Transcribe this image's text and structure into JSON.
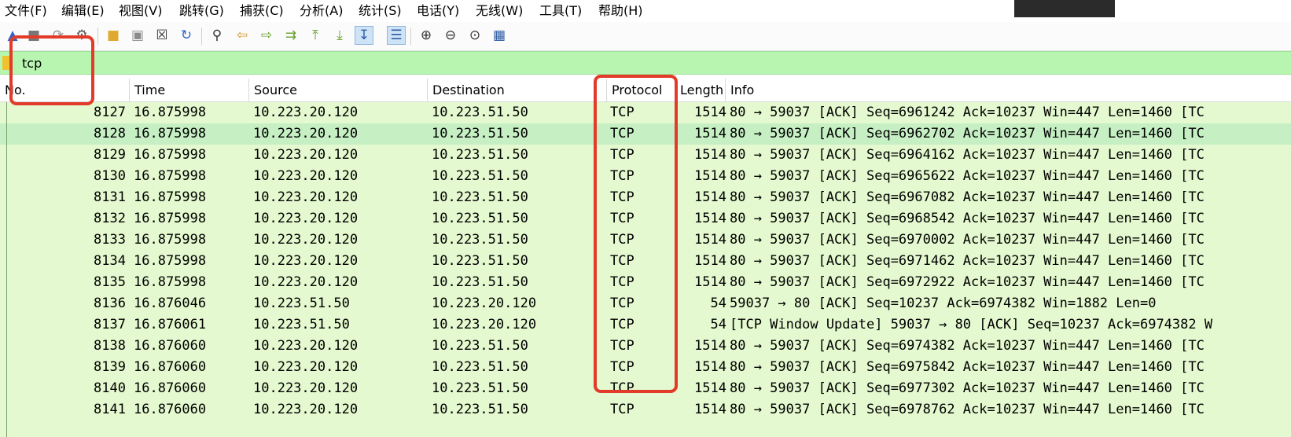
{
  "menu": [
    "文件(F)",
    "编辑(E)",
    "视图(V)",
    "跳转(G)",
    "捕获(C)",
    "分析(A)",
    "统计(S)",
    "电话(Y)",
    "无线(W)",
    "工具(T)",
    "帮助(H)"
  ],
  "toolbar": {
    "icons": [
      "shark-fin-icon",
      "stop-icon",
      "restart-icon",
      "options-gear-icon",
      "open-folder-icon",
      "save-file-icon",
      "close-file-icon",
      "reload-icon",
      "find-icon",
      "back-arrow-icon",
      "forward-arrow-icon",
      "go-to-packet-icon",
      "first-packet-icon",
      "last-packet-icon",
      "autoscroll-icon",
      "colorize-icon",
      "zoom-in-icon",
      "zoom-out-icon",
      "zoom-reset-icon",
      "resize-columns-icon"
    ]
  },
  "filter": {
    "value": "tcp"
  },
  "columns": {
    "no": "No.",
    "time": "Time",
    "source": "Source",
    "destination": "Destination",
    "protocol": "Protocol",
    "length": "Length",
    "info": "Info"
  },
  "packets": [
    {
      "no": "8127",
      "time": "16.875998",
      "src": "10.223.20.120",
      "dst": "10.223.51.50",
      "proto": "TCP",
      "len": "1514",
      "info": "80 → 59037 [ACK] Seq=6961242 Ack=10237 Win=447 Len=1460 [TC"
    },
    {
      "no": "8128",
      "time": "16.875998",
      "src": "10.223.20.120",
      "dst": "10.223.51.50",
      "proto": "TCP",
      "len": "1514",
      "info": "80 → 59037 [ACK] Seq=6962702 Ack=10237 Win=447 Len=1460 [TC"
    },
    {
      "no": "8129",
      "time": "16.875998",
      "src": "10.223.20.120",
      "dst": "10.223.51.50",
      "proto": "TCP",
      "len": "1514",
      "info": "80 → 59037 [ACK] Seq=6964162 Ack=10237 Win=447 Len=1460 [TC"
    },
    {
      "no": "8130",
      "time": "16.875998",
      "src": "10.223.20.120",
      "dst": "10.223.51.50",
      "proto": "TCP",
      "len": "1514",
      "info": "80 → 59037 [ACK] Seq=6965622 Ack=10237 Win=447 Len=1460 [TC"
    },
    {
      "no": "8131",
      "time": "16.875998",
      "src": "10.223.20.120",
      "dst": "10.223.51.50",
      "proto": "TCP",
      "len": "1514",
      "info": "80 → 59037 [ACK] Seq=6967082 Ack=10237 Win=447 Len=1460 [TC"
    },
    {
      "no": "8132",
      "time": "16.875998",
      "src": "10.223.20.120",
      "dst": "10.223.51.50",
      "proto": "TCP",
      "len": "1514",
      "info": "80 → 59037 [ACK] Seq=6968542 Ack=10237 Win=447 Len=1460 [TC"
    },
    {
      "no": "8133",
      "time": "16.875998",
      "src": "10.223.20.120",
      "dst": "10.223.51.50",
      "proto": "TCP",
      "len": "1514",
      "info": "80 → 59037 [ACK] Seq=6970002 Ack=10237 Win=447 Len=1460 [TC"
    },
    {
      "no": "8134",
      "time": "16.875998",
      "src": "10.223.20.120",
      "dst": "10.223.51.50",
      "proto": "TCP",
      "len": "1514",
      "info": "80 → 59037 [ACK] Seq=6971462 Ack=10237 Win=447 Len=1460 [TC"
    },
    {
      "no": "8135",
      "time": "16.875998",
      "src": "10.223.20.120",
      "dst": "10.223.51.50",
      "proto": "TCP",
      "len": "1514",
      "info": "80 → 59037 [ACK] Seq=6972922 Ack=10237 Win=447 Len=1460 [TC"
    },
    {
      "no": "8136",
      "time": "16.876046",
      "src": "10.223.51.50",
      "dst": "10.223.20.120",
      "proto": "TCP",
      "len": "54",
      "info": "59037 → 80 [ACK] Seq=10237 Ack=6974382 Win=1882 Len=0"
    },
    {
      "no": "8137",
      "time": "16.876061",
      "src": "10.223.51.50",
      "dst": "10.223.20.120",
      "proto": "TCP",
      "len": "54",
      "info": "[TCP Window Update] 59037 → 80 [ACK] Seq=10237 Ack=6974382 W"
    },
    {
      "no": "8138",
      "time": "16.876060",
      "src": "10.223.20.120",
      "dst": "10.223.51.50",
      "proto": "TCP",
      "len": "1514",
      "info": "80 → 59037 [ACK] Seq=6974382 Ack=10237 Win=447 Len=1460 [TC"
    },
    {
      "no": "8139",
      "time": "16.876060",
      "src": "10.223.20.120",
      "dst": "10.223.51.50",
      "proto": "TCP",
      "len": "1514",
      "info": "80 → 59037 [ACK] Seq=6975842 Ack=10237 Win=447 Len=1460 [TC"
    },
    {
      "no": "8140",
      "time": "16.876060",
      "src": "10.223.20.120",
      "dst": "10.223.51.50",
      "proto": "TCP",
      "len": "1514",
      "info": "80 → 59037 [ACK] Seq=6977302 Ack=10237 Win=447 Len=1460 [TC"
    },
    {
      "no": "8141",
      "time": "16.876060",
      "src": "10.223.20.120",
      "dst": "10.223.51.50",
      "proto": "TCP",
      "len": "1514",
      "info": "80 → 59037 [ACK] Seq=6978762 Ack=10237 Win=447 Len=1460 [TC"
    }
  ],
  "selected_packet": "8128",
  "colors": {
    "filter_valid": "#b8f5b0",
    "tcp_row": "#e4f9cf",
    "selected_row": "#c6efc4",
    "annotation": "#e23b2a"
  }
}
